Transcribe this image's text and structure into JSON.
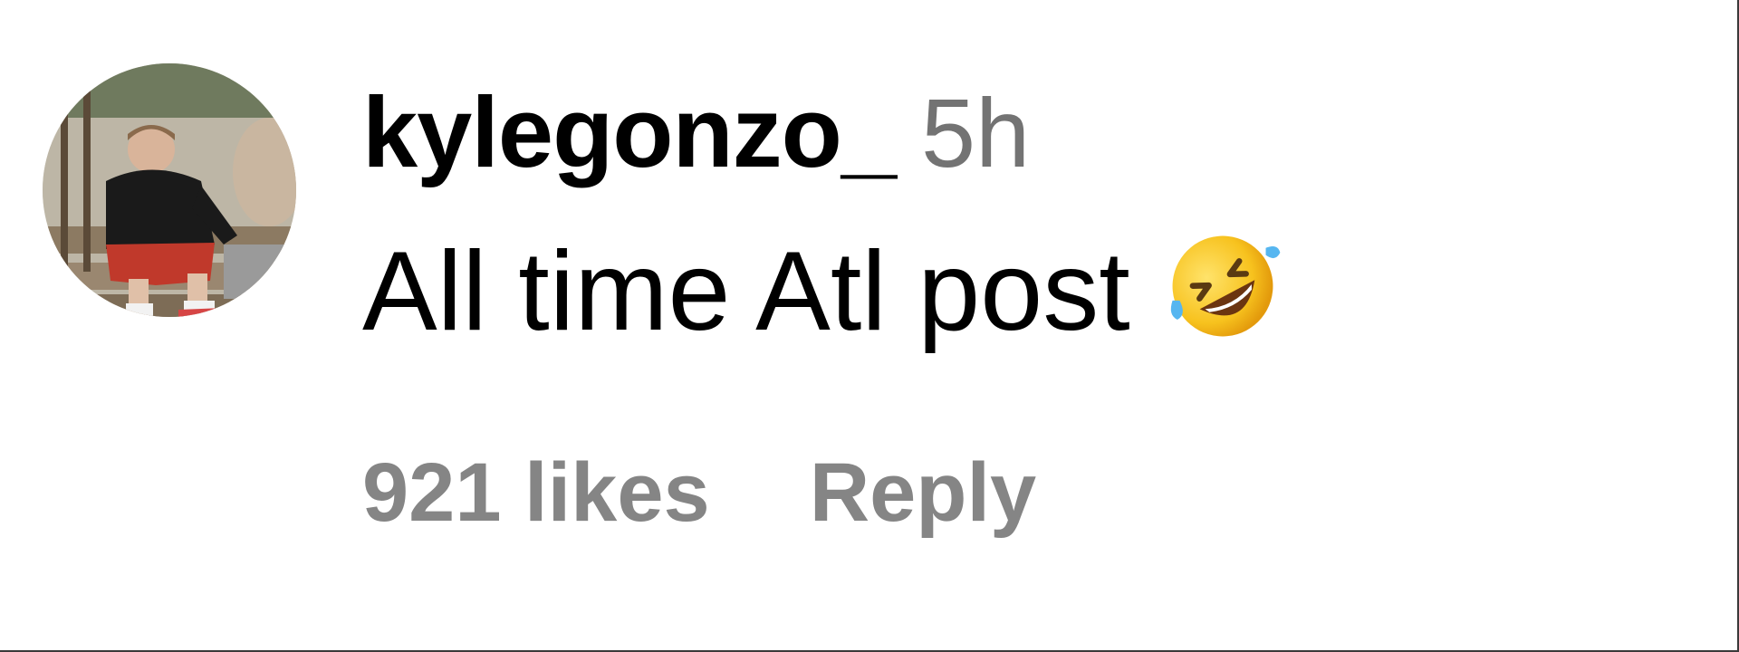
{
  "comment": {
    "username": "kylegonzo_",
    "time_ago": "5h",
    "text": "All time Atl post",
    "emoji": "rolling-on-the-floor-laughing",
    "likes_label": "921 likes",
    "reply_label": "Reply"
  },
  "colors": {
    "username": "#000000",
    "secondary_text": "#737373",
    "meta_text": "#858585",
    "background": "#ffffff"
  }
}
